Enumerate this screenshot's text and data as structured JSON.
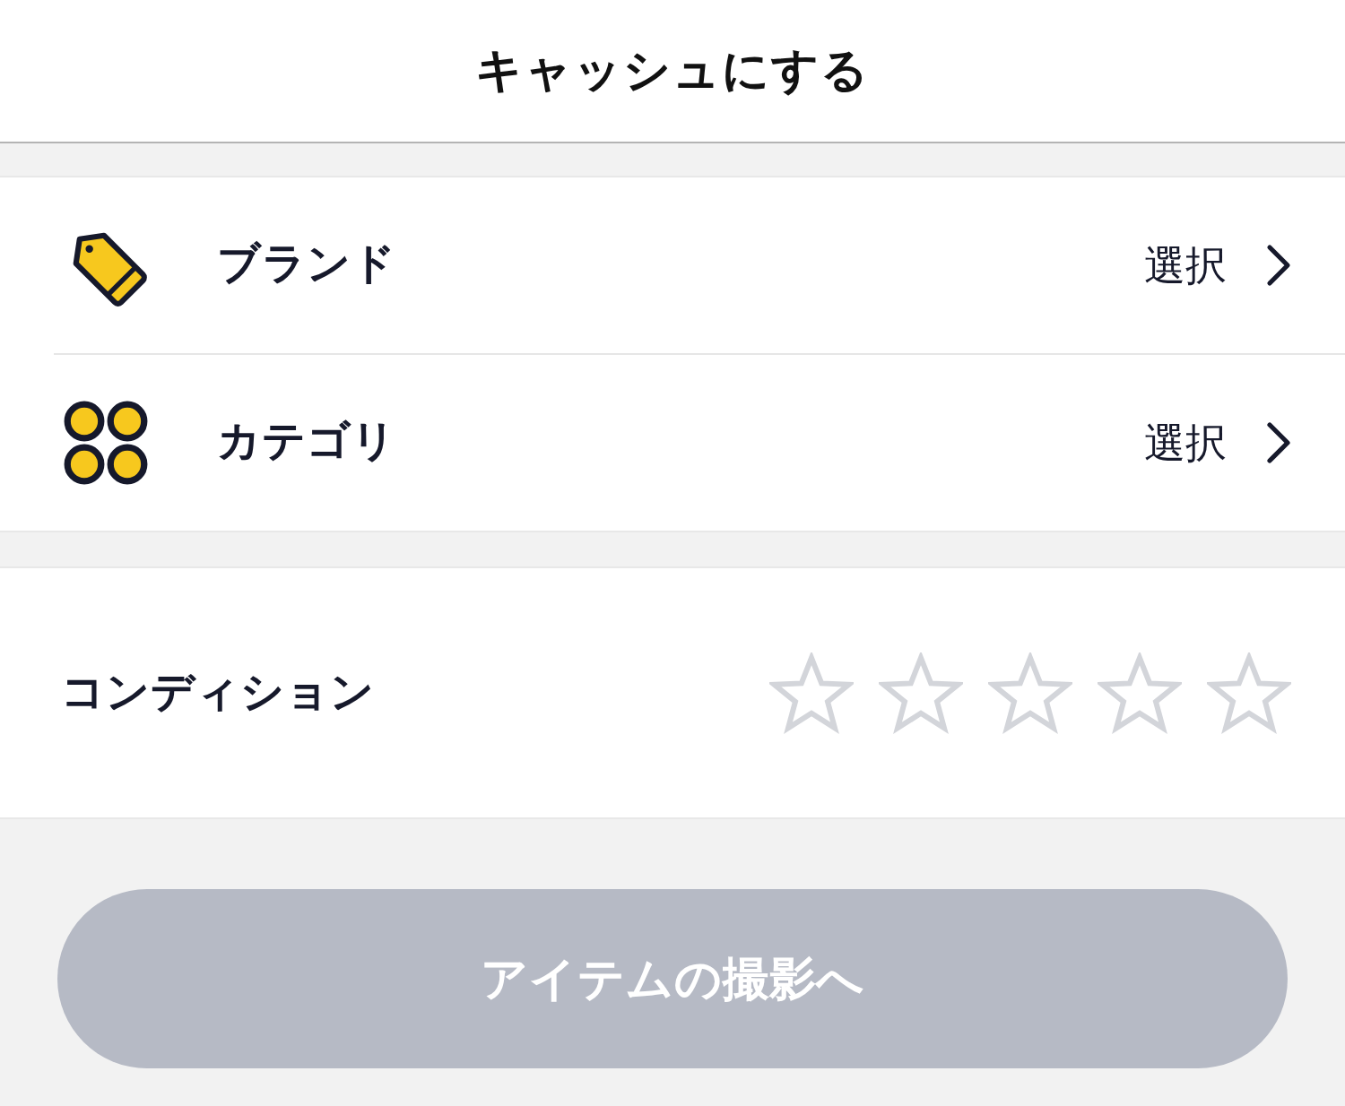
{
  "header": {
    "title": "キャッシュにする"
  },
  "selectors": [
    {
      "kind": "tag",
      "label": "ブランド",
      "value": "選択"
    },
    {
      "kind": "category",
      "label": "カテゴリ",
      "value": "選択"
    }
  ],
  "condition": {
    "label": "コンディション",
    "stars": 0
  },
  "next_button": {
    "label": "アイテムの撮影へ",
    "disabled": true
  }
}
